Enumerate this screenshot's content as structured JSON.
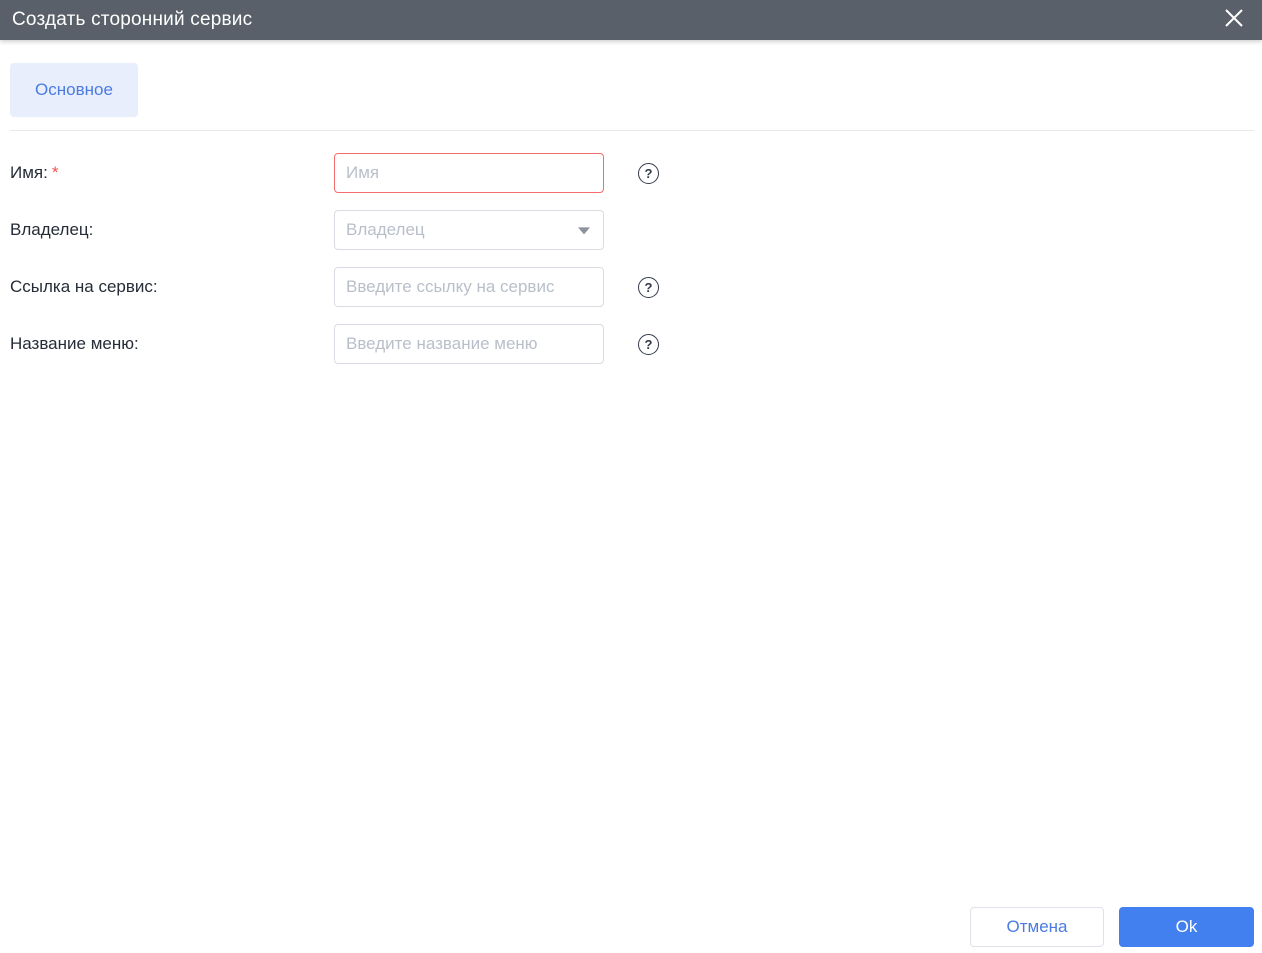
{
  "dialog": {
    "title": "Создать сторонний сервис"
  },
  "tabs": {
    "main": {
      "label": "Основное",
      "active": true
    }
  },
  "form": {
    "required_mark": "*",
    "fields": [
      {
        "label": "Имя:",
        "required": true,
        "control": "text-input",
        "placeholder": "Имя",
        "value": "",
        "state": "error",
        "has_help": true
      },
      {
        "label": "Владелец:",
        "required": false,
        "control": "dropdown",
        "placeholder": "Владелец",
        "value": "",
        "state": "default",
        "has_help": false
      },
      {
        "label": "Ссылка на сервис:",
        "required": false,
        "control": "text-input",
        "placeholder": "Введите ссылку на сервис",
        "value": "",
        "state": "default",
        "has_help": true
      },
      {
        "label": "Название меню:",
        "required": false,
        "control": "text-input",
        "placeholder": "Введите название меню",
        "value": "",
        "state": "default",
        "has_help": true
      }
    ]
  },
  "icons": {
    "help": "?",
    "close": "close-x",
    "dropdown_caret": "triangle-down"
  },
  "footer": {
    "cancel_label": "Отмена",
    "ok_label": "Ok"
  },
  "colors": {
    "header_bg": "#5a6069",
    "accent_blue": "#4180ee",
    "tab_bg": "#e9eefc",
    "tab_text": "#4a7be0",
    "error_border_red": "#f56c6c",
    "asterisk_red": "#f0544f",
    "placeholder_gray": "#b9bfc9",
    "border_gray": "#d9dce2"
  }
}
